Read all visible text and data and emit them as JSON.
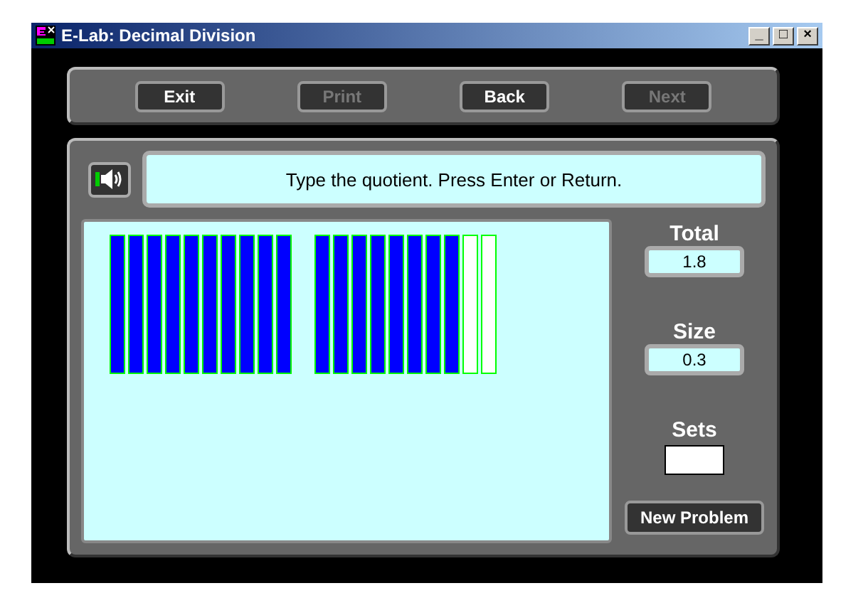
{
  "window": {
    "title": "E-Lab: Decimal Division",
    "controls": [
      "_",
      "□",
      "×"
    ]
  },
  "toolbar": [
    {
      "label": "Exit",
      "disabled": false
    },
    {
      "label": "Print",
      "disabled": true
    },
    {
      "label": "Back",
      "disabled": false
    },
    {
      "label": "Next",
      "disabled": true
    }
  ],
  "message": "Type the quotient.  Press Enter or Return.",
  "groups": [
    {
      "bars": [
        {
          "filled": true
        },
        {
          "filled": true
        },
        {
          "filled": true
        },
        {
          "filled": true
        },
        {
          "filled": true
        },
        {
          "filled": true
        },
        {
          "filled": true
        },
        {
          "filled": true
        },
        {
          "filled": true
        },
        {
          "filled": true
        }
      ]
    },
    {
      "bars": [
        {
          "filled": true
        },
        {
          "filled": true
        },
        {
          "filled": true
        },
        {
          "filled": true
        },
        {
          "filled": true
        },
        {
          "filled": true
        },
        {
          "filled": true
        },
        {
          "filled": true
        },
        {
          "filled": false
        },
        {
          "filled": false
        }
      ]
    }
  ],
  "fields": [
    {
      "label": "Total",
      "value": "1.8"
    },
    {
      "label": "Size",
      "value": "0.3"
    }
  ],
  "answer": {
    "label": "Sets"
  },
  "new_problem": "New Problem"
}
